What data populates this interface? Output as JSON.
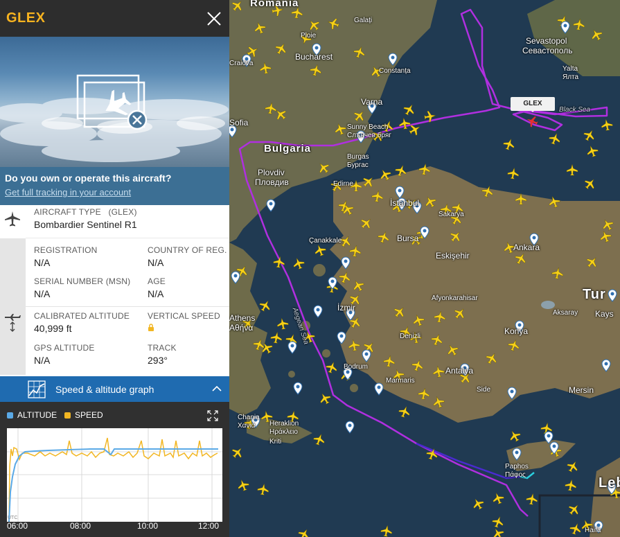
{
  "panel": {
    "callsign": "GLEX",
    "own_question": "Do you own or operate this aircraft?",
    "own_link": "Get full tracking in your account",
    "aircraft_type_label": "AIRCRAFT TYPE",
    "aircraft_type_code": "(GLEX)",
    "aircraft_type_value": "Bombardier Sentinel R1",
    "registration_label": "REGISTRATION",
    "registration_value": "N/A",
    "country_label": "COUNTRY OF REG.",
    "country_value": "N/A",
    "serial_label": "SERIAL NUMBER (MSN)",
    "serial_value": "N/A",
    "age_label": "AGE",
    "age_value": "N/A",
    "cal_alt_label": "CALIBRATED ALTITUDE",
    "cal_alt_value": "40,999 ft",
    "vspeed_label": "VERTICAL SPEED",
    "gps_alt_label": "GPS ALTITUDE",
    "gps_alt_value": "N/A",
    "track_label": "TRACK",
    "track_value": "293°"
  },
  "graph": {
    "title": "Speed & altitude graph",
    "legend_altitude": "ALTITUDE",
    "legend_speed": "SPEED",
    "altitude_color": "#5aa9e6",
    "speed_color": "#f2b622",
    "ticks": [
      "06:00",
      "08:00",
      "10:00",
      "12:00"
    ],
    "utc_label": "UTC"
  },
  "map": {
    "selected_tag": "GLEX",
    "labels": {
      "romania": "Romania",
      "galati": "Galați",
      "sevastopol": "Sevastopol",
      "sevastopol_cyr": "Севастополь",
      "yalta": "Yalta",
      "yalta_cyr": "Ялта",
      "craiova": "Craiova",
      "ploiesti": "Ploie",
      "bucharest": "Bucharest",
      "constanta": "Constanța",
      "varna": "Varna",
      "sofia": "Sofia",
      "bulgaria": "Bulgaria",
      "sunny_beach": "Sunny Beach",
      "sunny_beach_cyr": "Слънчев бряг",
      "burgas": "Burgas",
      "burgas_cyr": "Бургас",
      "black_sea": "Black Sea",
      "plovdiv": "Plovdiv",
      "plovdiv_cyr": "Пловдив",
      "edirne": "Edirne",
      "istanbul": "İstanbul",
      "sakarya": "Sakarya",
      "bursa": "Bursa",
      "canakkale": "Çanakkale",
      "eskisehir": "Eskişehir",
      "ankara": "Ankara",
      "izmir": "İzmir",
      "afyonkarahisar": "Afyonkarahisar",
      "aksaray": "Aksaray",
      "turkey": "Tur",
      "kayseri": "Kays",
      "athens": "Athens",
      "athens_gr": "Αθήνα",
      "aegean_sea": "Aegean Sea",
      "denizli": "Denizli",
      "konya": "Konya",
      "bodrum": "Bodrum",
      "marmaris": "Marmaris",
      "antalya": "Antalya",
      "side": "Side",
      "mersin": "Mersin",
      "chania": "Chania",
      "chania_gr": "Χανιά",
      "heraklion": "Heraklion",
      "heraklion_gr": "Ηράκλειο",
      "crete": "Kriti",
      "paphos": "Paphos",
      "paphos_gr": "Πάφος",
      "lebanon": "Leb",
      "haifa": "Haifa"
    }
  },
  "colors": {
    "accent": "#f7b31f",
    "panel_header": "#2d2d2d",
    "graph_bar": "#1f6bb0",
    "track_purple": "#b02fe0",
    "aircraft_yellow": "#f6d017"
  }
}
